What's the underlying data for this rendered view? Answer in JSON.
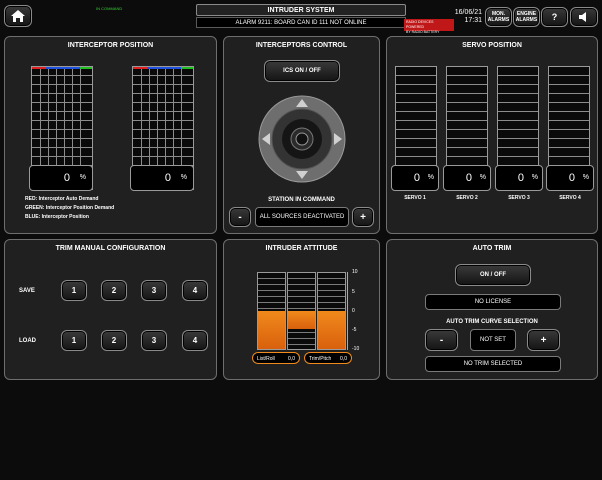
{
  "header": {
    "command_status": "IN COMMAND",
    "system_title": "INTRUDER SYSTEM",
    "alarm_text": "ALARM 9211: BOARD CAN ID 111 NOT ONLINE",
    "radio_warning_line1": "RADIO DEVICES POWERED",
    "radio_warning_line2": "BY RADIO BATTERY",
    "date": "16/06/21",
    "time": "17:31",
    "mon_alarms_line1": "MON.",
    "mon_alarms_line2": "ALARMS",
    "engine_alarms_line1": "ENGINE",
    "engine_alarms_line2": "ALARMS",
    "help_label": "?",
    "home_icon": "home-icon",
    "speaker_icon": "speaker-icon"
  },
  "interceptor_position": {
    "title": "INTERCEPTOR POSITION",
    "left_value": "0",
    "right_value": "0",
    "unit": "%",
    "legend_red": "RED: Interceptor Auto Demand",
    "legend_green": "GREEN: Interceptor Position Demand",
    "legend_blue": "BLUE: Interceptor Position",
    "colors": {
      "red": "#e02020",
      "green": "#20c020",
      "blue": "#2050e0"
    }
  },
  "interceptors_control": {
    "title": "INTERCEPTORS CONTROL",
    "ics_button": "ICS ON / OFF",
    "station_label": "STATION IN COMMAND",
    "station_value": "ALL SOURCES DEACTIVATED",
    "minus": "-",
    "plus": "+",
    "joystick_icon": "joystick-icon"
  },
  "servo_position": {
    "title": "SERVO POSITION",
    "unit": "%",
    "servos": [
      {
        "name": "SERVO 1",
        "value": "0"
      },
      {
        "name": "SERVO 2",
        "value": "0"
      },
      {
        "name": "SERVO 3",
        "value": "0"
      },
      {
        "name": "SERVO 4",
        "value": "0"
      }
    ]
  },
  "trim_manual": {
    "title": "TRIM MANUAL CONFIGURATION",
    "save_label": "SAVE",
    "load_label": "LOAD",
    "slots": [
      "1",
      "2",
      "3",
      "4"
    ]
  },
  "intruder_attitude": {
    "title": "INTRUDER ATTITUDE",
    "scale": [
      "10",
      "5",
      "0",
      "-5",
      "-10"
    ],
    "list_roll_label": "List/Roll",
    "list_roll_value": "0,0",
    "trim_pitch_label": "Trim/Pitch",
    "trim_pitch_value": "0,0",
    "accent": "#f08a1c"
  },
  "auto_trim": {
    "title": "AUTO TRIM",
    "on_off": "ON / OFF",
    "license": "NO LICENSE",
    "curve_label": "AUTO TRIM CURVE SELECTION",
    "curve_value": "NOT SET",
    "minus": "-",
    "plus": "+",
    "status": "NO TRIM SELECTED"
  }
}
